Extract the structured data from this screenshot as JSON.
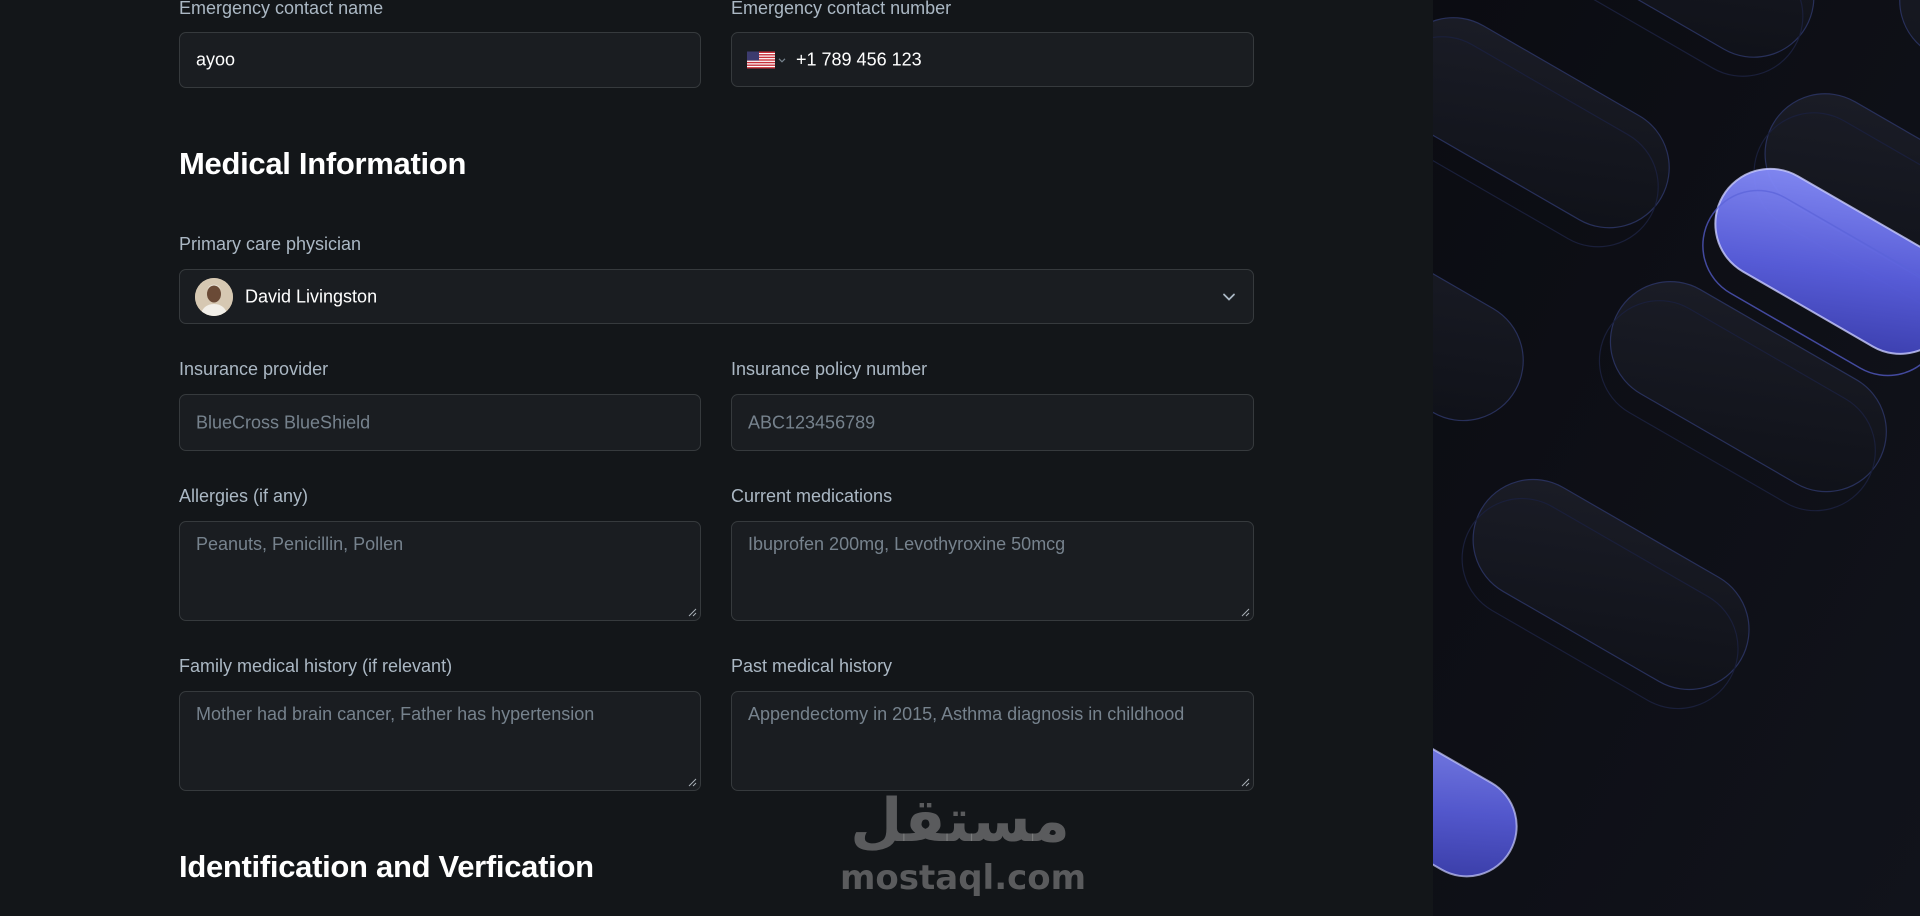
{
  "emergency": {
    "name_label": "Emergency contact name",
    "name_value": "ayoo",
    "number_label": "Emergency contact number",
    "number_value": "+1 789 456 123"
  },
  "medical": {
    "heading": "Medical Information",
    "physician_label": "Primary care physician",
    "physician_value": "David Livingston",
    "insurance_provider_label": "Insurance provider",
    "insurance_provider_placeholder": "BlueCross BlueShield",
    "policy_label": "Insurance policy number",
    "policy_placeholder": "ABC123456789",
    "allergies_label": "Allergies (if any)",
    "allergies_placeholder": "Peanuts, Penicillin, Pollen",
    "medications_label": "Current medications",
    "medications_placeholder": "Ibuprofen 200mg, Levothyroxine 50mcg",
    "family_label": "Family medical history (if relevant)",
    "family_placeholder": "Mother had brain cancer, Father has hypertension",
    "past_label": "Past medical history",
    "past_placeholder": "Appendectomy in 2015, Asthma diagnosis in childhood"
  },
  "identification": {
    "heading": "Identification and Verfication"
  },
  "watermark": {
    "arabic": "مستقل",
    "latin": "mostaql.com"
  },
  "icons": {
    "country_flag": "us-flag-icon",
    "country_chevron": "chevron-down-icon",
    "physician_avatar": "avatar",
    "select_chevron": "chevron-down-icon",
    "textarea_resize": "resize-handle-icon"
  },
  "colors": {
    "background": "#131619",
    "field_bg": "#1a1d21",
    "field_border": "#363a3d",
    "label": "#abb8c4",
    "placeholder": "#76828d",
    "heading": "#ffffff",
    "art_accent": "#5b5fd9"
  }
}
